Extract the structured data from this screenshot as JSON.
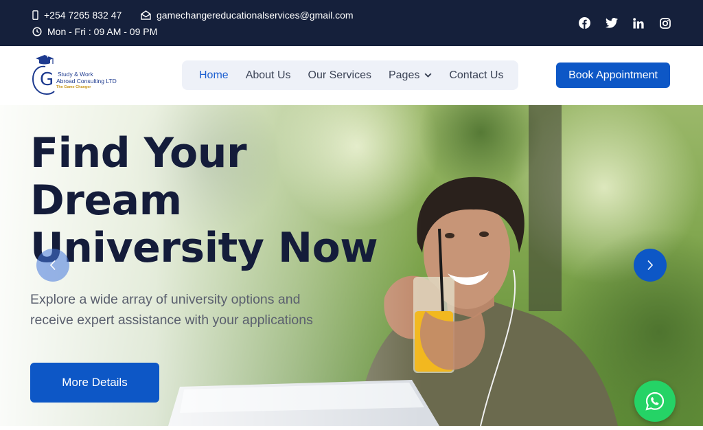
{
  "topbar": {
    "phone": "+254 7265 832 47",
    "email": "gamechangereducationalservices@gmail.com",
    "hours": "Mon - Fri : 09 AM - 09 PM",
    "socials": [
      "facebook-icon",
      "twitter-icon",
      "linkedin-icon",
      "instagram-icon"
    ]
  },
  "logo": {
    "letter": "G",
    "line1": "Study  & Work",
    "line2": "Abroad Consulting LTD",
    "tagline": "The Game Changer"
  },
  "nav": {
    "items": [
      {
        "label": "Home",
        "active": true
      },
      {
        "label": "About Us"
      },
      {
        "label": "Our Services"
      },
      {
        "label": "Pages",
        "dropdown": true
      },
      {
        "label": "Contact Us"
      }
    ],
    "cta": "Book Appointment"
  },
  "hero": {
    "title_lines": [
      "Find Your",
      "Dream",
      "University Now"
    ],
    "subtitle": "Explore a wide array of university options and receive expert assistance with your applications",
    "button": "More Details"
  },
  "colors": {
    "topbar": "#15203b",
    "primary": "#0d57c6",
    "heading": "#141c3a",
    "whatsapp": "#25d366"
  }
}
